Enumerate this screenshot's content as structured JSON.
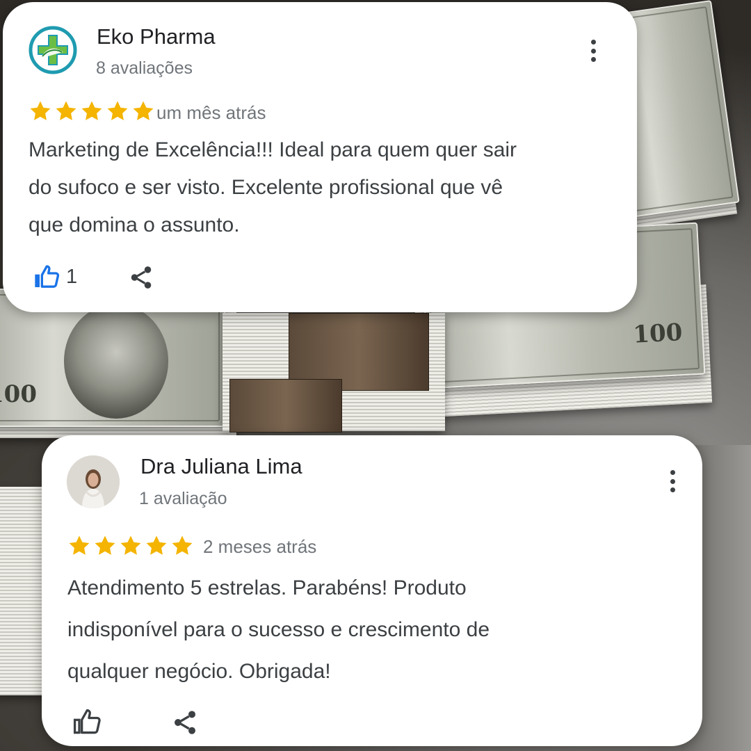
{
  "reviews": [
    {
      "reviewer": "Eko Pharma",
      "review_count": "8 avaliações",
      "rating": 5,
      "time": "um mês atrás",
      "text_lines": [
        "Marketing de Excelência!!! Ideal para quem quer sair",
        "do sufoco e ser visto. Excelente profissional que vê",
        "que domina o assunto."
      ],
      "likes": "1",
      "like_active": true
    },
    {
      "reviewer": "Dra Juliana Lima",
      "review_count": "1 avaliação",
      "rating": 5,
      "time": "2 meses atrás",
      "text_lines": [
        "Atendimento 5 estrelas.  Parabéns! Produto",
        "indisponível para o sucesso e crescimento de",
        "qualquer negócio.  Obrigada!"
      ],
      "likes": "",
      "like_active": false
    }
  ],
  "icons": {
    "star": "star-icon",
    "like": "thumbs-up-icon",
    "share": "share-icon",
    "menu": "more-vertical-icon"
  },
  "colors": {
    "star": "#F4B400",
    "like_active": "#1A73E8",
    "text": "#3C4043",
    "muted": "#70757A",
    "logo_teal": "#1F9BB0",
    "logo_green": "#6BBE45"
  }
}
